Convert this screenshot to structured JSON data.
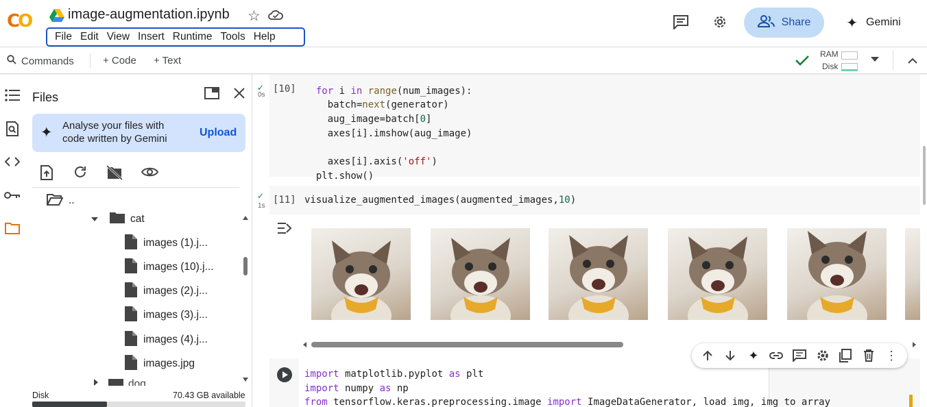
{
  "app": {
    "logo_text": "CO",
    "notebook_title": "image-augmentation.ipynb"
  },
  "menu": [
    "File",
    "Edit",
    "View",
    "Insert",
    "Runtime",
    "Tools",
    "Help"
  ],
  "header_right": {
    "share_label": "Share",
    "gemini_label": "Gemini"
  },
  "toolbar": {
    "commands_label": "Commands",
    "code_label": "+ Code",
    "text_label": "+ Text",
    "ram_label": "RAM",
    "disk_label": "Disk"
  },
  "files_panel": {
    "title": "Files",
    "gemini_card_text_1": "Analyse your files with",
    "gemini_card_text_2": "code written by Gemini",
    "upload_label": "Upload",
    "tree": [
      {
        "label": "..",
        "type": "folder-up"
      },
      {
        "label": "cat",
        "type": "folder"
      },
      {
        "label": "images (1).j...",
        "type": "file"
      },
      {
        "label": "images (10).j...",
        "type": "file"
      },
      {
        "label": "images (2).j...",
        "type": "file"
      },
      {
        "label": "images (3).j...",
        "type": "file"
      },
      {
        "label": "images (4).j...",
        "type": "file"
      },
      {
        "label": "images.jpg",
        "type": "file"
      },
      {
        "label": "dog",
        "type": "folder"
      }
    ],
    "disk_label": "Disk",
    "disk_available": "70.43 GB available",
    "disk_used_fraction": 0.35
  },
  "cells": {
    "cell10": {
      "exec_count": "[10]",
      "time": "0s",
      "lines": [
        "  for i in range(num_images):",
        "    batch=next(generator)",
        "    aug_image=batch[0]",
        "    axes[i].imshow(aug_image)",
        "",
        "    axes[i].axis('off')",
        "  plt.show()"
      ]
    },
    "cell11": {
      "exec_count": "[11]",
      "time": "1s",
      "source": "visualize_augmented_images(augmented_images,10)",
      "output_images": 6
    },
    "cell12": {
      "lines": [
        "import matplotlib.pyplot as plt",
        "import numpy as np",
        "from tensorflow.keras.preprocessing.image import ImageDataGenerator, load_img, img_to_array"
      ]
    }
  },
  "colors": {
    "accent": "#1a73e8",
    "share_bg": "#c2dcf7",
    "success": "#188038",
    "gemini_card_bg": "#d3e3fd"
  }
}
